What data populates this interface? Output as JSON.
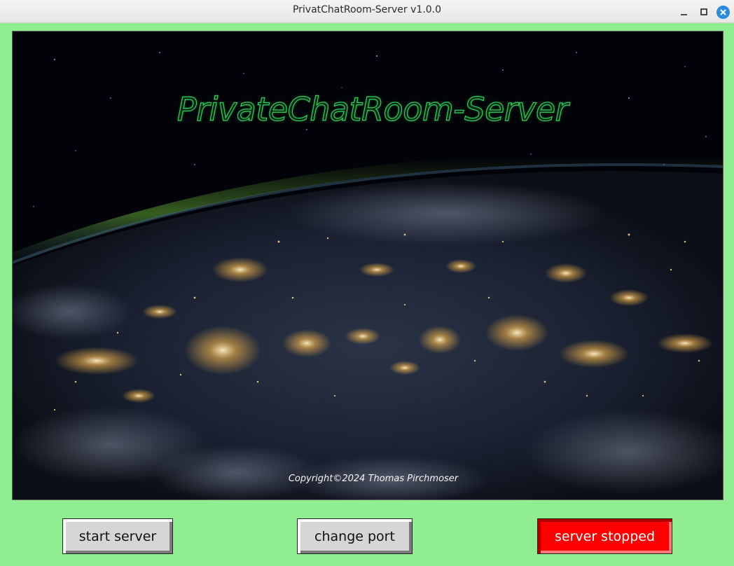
{
  "window": {
    "title": "PrivatChatRoom-Server v1.0.0",
    "controls": [
      "minimize-icon",
      "maximize-icon",
      "close-icon"
    ],
    "background_color": "#90ee90"
  },
  "banner": {
    "heading": "PrivateChatRoom-Server",
    "copyright": "Copyright©2024 Thomas Pirchmoser",
    "heading_color": "#2fd05c"
  },
  "buttons": {
    "start_label": "start server",
    "port_label": "change port",
    "status_label": "server stopped",
    "status_color": "#ff0000"
  }
}
